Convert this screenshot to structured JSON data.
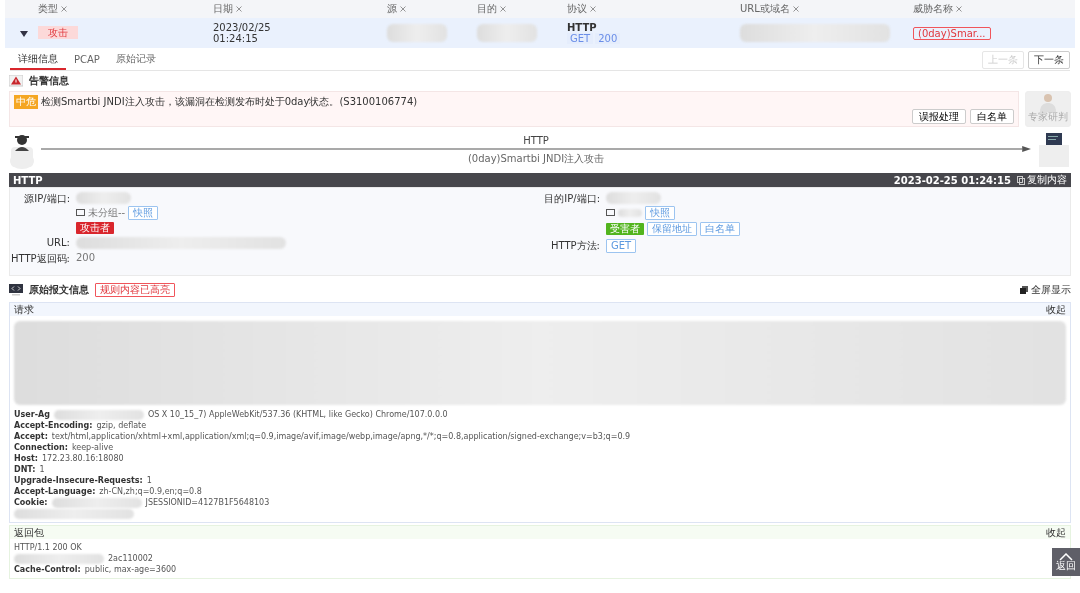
{
  "table": {
    "columns": [
      "类型",
      "日期",
      "源",
      "目的",
      "协议",
      "URL或域名",
      "威胁名称"
    ],
    "row": {
      "expanded": true,
      "type_tag": "攻击",
      "date": [
        "2023/02/25",
        "01:24:15"
      ],
      "protocol": "HTTP",
      "method": "GET",
      "status": "200",
      "threat_tag": "(0day)Smar..."
    }
  },
  "tabs": [
    {
      "label": "详细信息",
      "selected": true
    },
    {
      "label": "PCAP",
      "selected": false
    },
    {
      "label": "原始记录",
      "selected": false
    }
  ],
  "nav_buttons": [
    {
      "label": "上一条",
      "disabled": true
    },
    {
      "label": "下一条",
      "disabled": false
    }
  ],
  "alert": {
    "title": "告警信息",
    "severity": "中危",
    "message": "检测Smartbi JNDI注入攻击，该漏洞在检测发布时处于0day状态。(S3100106774)",
    "buttons": [
      "误报处理",
      "白名单"
    ],
    "expert": "专家研判"
  },
  "flow": {
    "protocol": "HTTP",
    "attack": "(0day)Smartbi JNDI注入攻击"
  },
  "http_panel": {
    "title": "HTTP",
    "time": "2023-02-25 01:24:15",
    "copy": "复制内容",
    "left": [
      {
        "label": "源IP/端口:",
        "group": "未分组--",
        "snapshot": "快照",
        "tags": [
          {
            "text": "攻击者",
            "kind": "danger"
          }
        ]
      },
      {
        "label": "URL:"
      },
      {
        "label": "HTTP返回码:",
        "value": "200"
      }
    ],
    "right": [
      {
        "label": "目的IP/端口:",
        "snapshot": "快照",
        "tags": [
          {
            "text": "受害者",
            "kind": "success"
          },
          {
            "text": "保留地址",
            "kind": "info"
          },
          {
            "text": "白名单",
            "kind": "info"
          }
        ]
      },
      {
        "label": "HTTP方法:",
        "method": "GET"
      }
    ]
  },
  "raw": {
    "title": "原始报文信息",
    "badge": "规则内容已高亮",
    "fullscreen": "全屏显示",
    "request": {
      "title": "请求",
      "collapse": "收起",
      "lines": [
        {
          "key": "User-Ag",
          "value": "OS X 10_15_7) AppleWebKit/537.36 (KHTML, like Gecko) Chrome/107.0.0.0",
          "redacted": true
        },
        {
          "key": "Accept-Encoding:",
          "value": "gzip, deflate",
          "redacted": false
        },
        {
          "key": "Accept:",
          "value": "text/html,application/xhtml+xml,application/xml;q=0.9,image/avif,image/webp,image/apng,*/*;q=0.8,application/signed-exchange;v=b3;q=0.9",
          "redacted": false
        },
        {
          "key": "Connection:",
          "value": "keep-alive",
          "redacted": false
        },
        {
          "key": "Host:",
          "value": "172.23.80.16:18080",
          "redacted": false
        },
        {
          "key": "DNT:",
          "value": "1",
          "redacted": false
        },
        {
          "key": "Upgrade-Insecure-Requests:",
          "value": "1",
          "redacted": false
        },
        {
          "key": "Accept-Language:",
          "value": "zh-CN,zh;q=0.9,en;q=0.8",
          "redacted": false
        },
        {
          "key": "Cookie:",
          "value": "JSESSIONID=4127B1F5648103",
          "redacted": true
        }
      ]
    },
    "response": {
      "title": "返回包",
      "collapse": "收起",
      "lines": [
        {
          "value": "HTTP/1.1 200 OK",
          "redacted": false
        },
        {
          "value": "2ac110002",
          "redacted": true
        },
        {
          "key": "Cache-Control:",
          "value": "public, max-age=3600",
          "redacted": false
        }
      ]
    }
  },
  "back_to_top": "返回"
}
